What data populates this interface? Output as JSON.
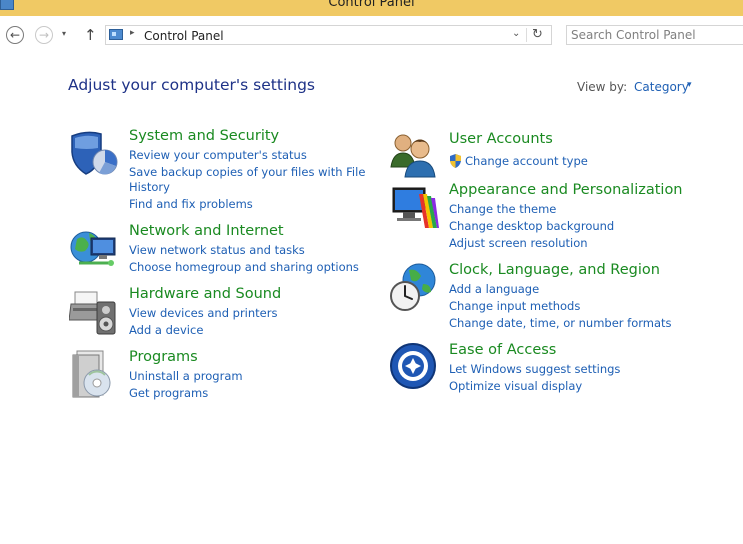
{
  "window": {
    "title": "Control Panel"
  },
  "nav": {
    "back_glyph": "←",
    "forward_glyph": "→",
    "recent_glyph": "▾",
    "up_glyph": "↑",
    "breadcrumb_sep": "▸",
    "breadcrumb": "Control Panel",
    "dropdown_glyph": "⌄",
    "refresh_glyph": "↻",
    "search_placeholder": "Search Control Panel"
  },
  "page": {
    "heading": "Adjust your computer's settings",
    "view_by_label": "View by:",
    "view_by_value": "Category",
    "view_by_caret": "▾"
  },
  "categories": [
    {
      "name": "System and Security",
      "icon": "shield-pie-icon",
      "links": [
        "Review your computer's status",
        "Save backup copies of your files with File",
        "History",
        "Find and fix problems"
      ]
    },
    {
      "name": "Network and Internet",
      "icon": "network-globe-icon",
      "links": [
        "View network status and tasks",
        "Choose homegroup and sharing options"
      ]
    },
    {
      "name": "Hardware and Sound",
      "icon": "printer-speaker-icon",
      "links": [
        "View devices and printers",
        "Add a device"
      ]
    },
    {
      "name": "Programs",
      "icon": "programs-disc-icon",
      "links": [
        "Uninstall a program",
        "Get programs"
      ]
    },
    {
      "name": "User Accounts",
      "icon": "users-icon",
      "links": [
        "Change account type"
      ]
    },
    {
      "name": "Appearance and Personalization",
      "icon": "monitor-palette-icon",
      "links": [
        "Change the theme",
        "Change desktop background",
        "Adjust screen resolution"
      ]
    },
    {
      "name": "Clock, Language, and Region",
      "icon": "clock-globe-icon",
      "links": [
        "Add a language",
        "Change input methods",
        "Change date, time, or number formats"
      ]
    },
    {
      "name": "Ease of Access",
      "icon": "ease-of-access-icon",
      "links": [
        "Let Windows suggest settings",
        "Optimize visual display"
      ]
    }
  ],
  "colors": {
    "titlebar": "#f0c964",
    "heading": "#1e3287",
    "category": "#1a8a21",
    "link": "#1e5fb4"
  }
}
